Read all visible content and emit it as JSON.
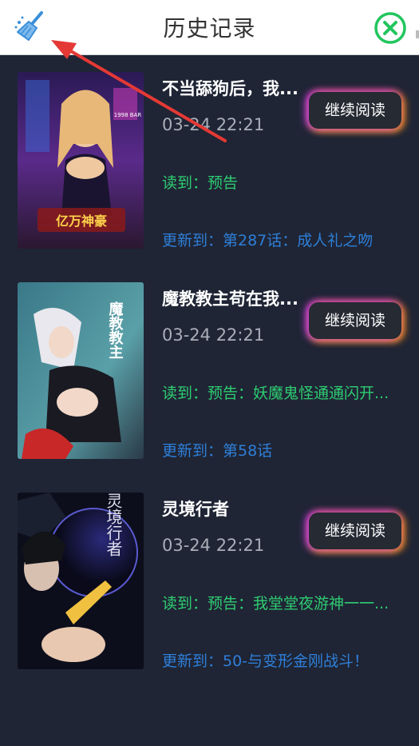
{
  "header": {
    "title": "历史记录"
  },
  "items": [
    {
      "title": "不当舔狗后，我...",
      "time": "03-24 22:21",
      "read": "读到：预告",
      "update": "更新到：第287话：成人礼之吻",
      "continue_label": "继续阅读",
      "cover_text": "1998 BAR",
      "cover_logo": "亿万神豪"
    },
    {
      "title": "魔教教主苟在我...",
      "time": "03-24 22:21",
      "read": "读到：预告：妖魔鬼怪通通闪开...",
      "update": "更新到：第58话",
      "continue_label": "继续阅读",
      "cover_text": "魔教教主"
    },
    {
      "title": "灵境行者",
      "time": "03-24 22:21",
      "read": "读到：预告：我堂堂夜游神一一...",
      "update": "更新到：50-与变形金刚战斗！",
      "continue_label": "继续阅读",
      "cover_text": "灵境行者"
    }
  ],
  "icons": {
    "clean": "broom-icon",
    "close": "close-circle-icon"
  },
  "colors": {
    "background": "#1f2535",
    "read_text": "#2ecc71",
    "update_text": "#2e7fd8",
    "close_icon": "#22c55e",
    "arrow": "#e53935"
  }
}
